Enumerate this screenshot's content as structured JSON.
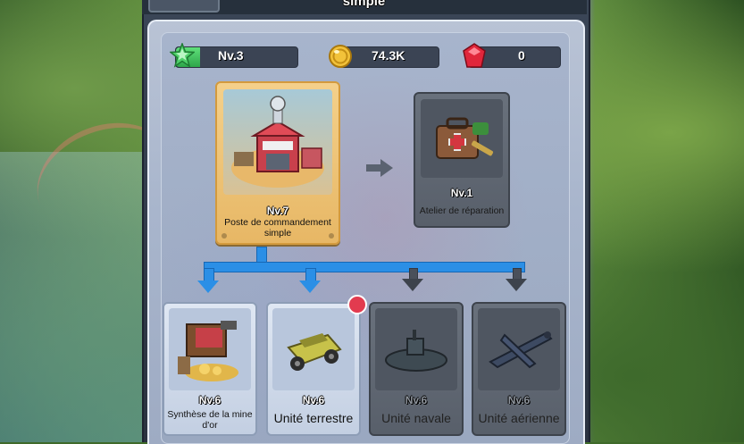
{
  "header": {
    "title": "simple"
  },
  "resources": {
    "level_label": "Nv.3",
    "xp_progress": 0.2,
    "coins_value": "74.3K",
    "gems_value": "0"
  },
  "colors": {
    "accent_blue": "#2b8fe6",
    "card_gold": "#f4d08a",
    "card_gray": "#69717c",
    "badge_red": "#e23b4f",
    "xp_green": "#3fc35e"
  },
  "main_building": {
    "level": "Nv.7",
    "name": "Poste de commandement simple",
    "icon": "command-post-icon"
  },
  "next_unlock": {
    "level": "Nv.1",
    "name": "Atelier de réparation",
    "icon": "repair-kit-icon"
  },
  "unlocks": [
    {
      "level": "Nv.6",
      "name": "Synthèse de la mine d'or",
      "icon": "gold-mine-icon",
      "state": "available"
    },
    {
      "level": "Nv.6",
      "name": "Unité terrestre",
      "icon": "jeep-icon",
      "state": "available"
    },
    {
      "level": "Nv.6",
      "name": "Unité navale",
      "icon": "submarine-icon",
      "state": "locked"
    },
    {
      "level": "Nv.6",
      "name": "Unité aérienne",
      "icon": "plane-icon",
      "state": "locked"
    }
  ]
}
